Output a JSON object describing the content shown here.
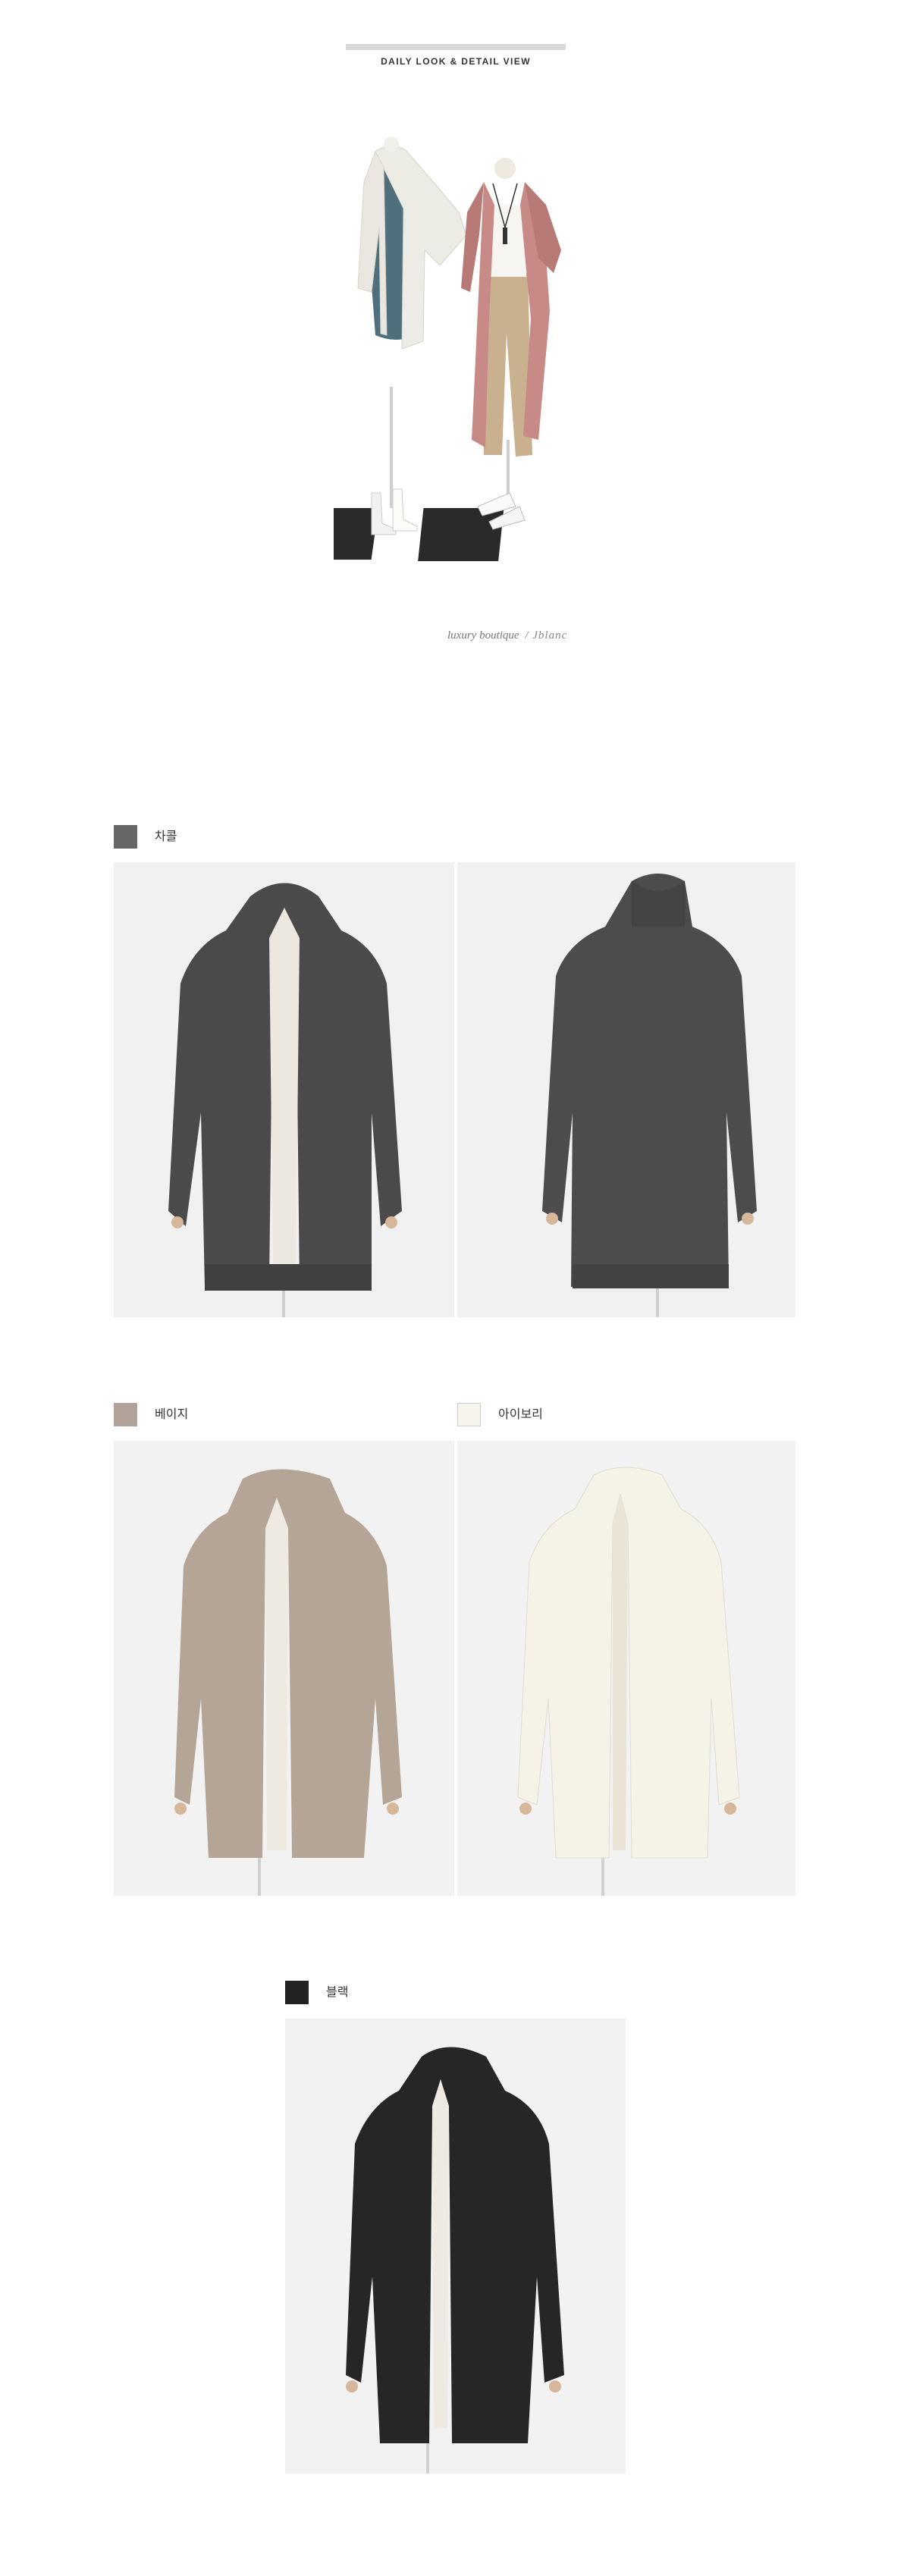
{
  "header": {
    "title": "DAILY LOOK & DETAIL VIEW"
  },
  "brand": {
    "text": "luxury boutique",
    "signature": "/ Jblanc"
  },
  "colors": {
    "swatches": [
      {
        "label": "차콜",
        "hex": "#666666"
      },
      {
        "label": "베이지",
        "hex": "#b2a39a"
      },
      {
        "label": "아이보리",
        "hex": "#f6f4ec"
      },
      {
        "label": "블랙",
        "hex": "#222222"
      }
    ]
  },
  "images": {
    "hero": "two-mannequins-styled-look",
    "charcoal_front": "charcoal-cardigan-front",
    "charcoal_back": "charcoal-cardigan-back",
    "beige_front": "beige-cardigan-front",
    "ivory_front": "ivory-cardigan-front",
    "black_front": "black-cardigan-front"
  }
}
